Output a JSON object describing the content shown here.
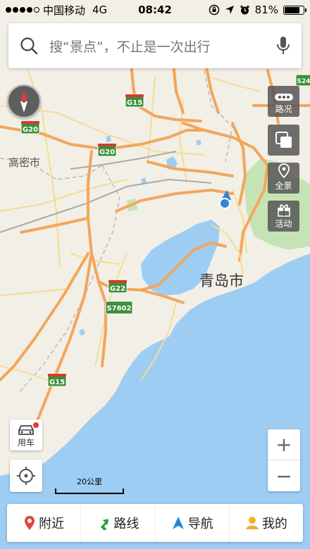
{
  "status_bar": {
    "carrier": "中国移动",
    "network": "4G",
    "time": "08:42",
    "battery": "81%",
    "battery_level": 0.81
  },
  "search": {
    "placeholder": "搜“景点”，不止是一次出行"
  },
  "right_tools": [
    {
      "label": "路况",
      "icon": "traffic-icon"
    },
    {
      "label": "",
      "icon": "layers-icon"
    },
    {
      "label": "全景",
      "icon": "panorama-pin-icon"
    },
    {
      "label": "活动",
      "icon": "gift-icon"
    }
  ],
  "map": {
    "cities": {
      "gaomi": "高密市",
      "qingdao": "青岛市"
    },
    "highways": {
      "g15_top": "G15",
      "g20_left": "G20",
      "g20_center": "G20",
      "g22": "G22",
      "s7602": "S7602",
      "g15_bottom": "G15",
      "s24": "S24"
    }
  },
  "car_button": {
    "label": "用车"
  },
  "zoom": {
    "in": "+",
    "out": "−"
  },
  "scale": {
    "label": "20公里"
  },
  "bottom_nav": [
    {
      "label": "附近",
      "icon": "location-pin-icon",
      "color": "#e0483a"
    },
    {
      "label": "路线",
      "icon": "route-arrow-icon",
      "color": "#2e9d3a"
    },
    {
      "label": "导航",
      "icon": "navigation-arrow-icon",
      "color": "#1f88d6"
    },
    {
      "label": "我的",
      "icon": "user-icon",
      "color": "#f0b323"
    }
  ],
  "colors": {
    "land": "#f2efe6",
    "sea": "#9ecdf3",
    "highway": "#f3a65c",
    "shield_green": "#3d8f3a",
    "park": "#c6e3b5"
  }
}
